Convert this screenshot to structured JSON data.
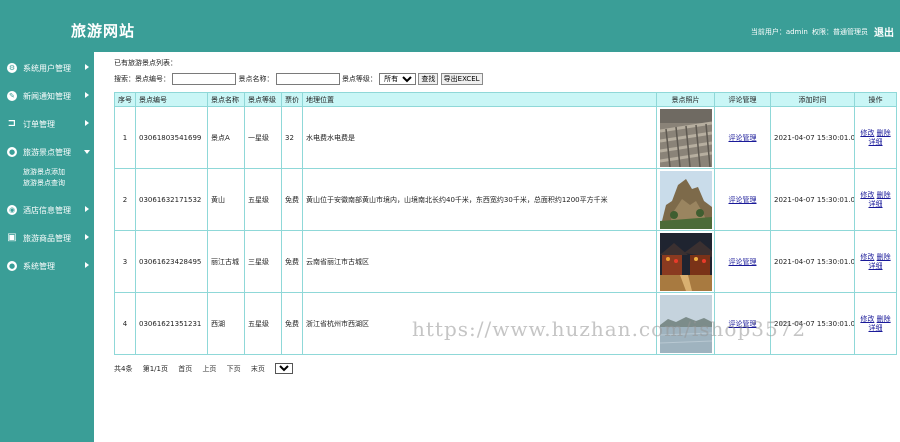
{
  "header": {
    "site_title": "旅游网站",
    "user_label": "当前用户：admin",
    "role_label": "权限：普通管理员",
    "logout_label": "退出",
    "bg_color": "#3a9e97"
  },
  "sidebar": {
    "items": [
      {
        "label": "系统用户管理",
        "icon": "settings-circle-icon"
      },
      {
        "label": "新闻通知管理",
        "icon": "edit-icon"
      },
      {
        "label": "订单管理",
        "icon": "bracket-icon"
      },
      {
        "label": "旅游景点管理",
        "icon": "people-icon"
      },
      {
        "label": "酒店信息管理",
        "icon": "circle-dot-icon"
      },
      {
        "label": "旅游商品管理",
        "icon": "box-icon"
      },
      {
        "label": "系统管理",
        "icon": "people-icon"
      }
    ],
    "sub_items": [
      "旅游景点添加",
      "旅游景点查询"
    ]
  },
  "main": {
    "list_caption": "已有旅游景点列表：",
    "search": {
      "prefix": "搜索：",
      "code_label": "景点编号：",
      "name_label": "景点名称：",
      "level_label": "景点等级：",
      "level_selected": "所有",
      "search_button": "查找",
      "export_button": "导出EXCEL"
    },
    "columns": [
      "序号",
      "景点编号",
      "景点名称",
      "景点等级",
      "票价",
      "地理位置",
      "景点照片",
      "评论管理",
      "添加时间",
      "操作"
    ],
    "rows": [
      {
        "no": "1",
        "code": "03061803541699",
        "name": "景点A",
        "level": "一星级",
        "price": "32",
        "location": "水电费水电费是",
        "photo": "terracotta-warriors",
        "comment": "评论管理",
        "time": "2021-04-07 15:30:01.0",
        "edit": "修改",
        "delete": "删除",
        "detail": "详细"
      },
      {
        "no": "2",
        "code": "03061632171532",
        "name": "黄山",
        "level": "五星级",
        "price": "免费",
        "location": "黄山位于安徽南部黄山市境内，山境南北长约40千米，东西宽约30千米，总面积约1200平方千米",
        "photo": "huangshan-mountain",
        "comment": "评论管理",
        "time": "2021-04-07 15:30:01.0",
        "edit": "修改",
        "delete": "删除",
        "detail": "详细"
      },
      {
        "no": "3",
        "code": "03061623428495",
        "name": "丽江古城",
        "level": "三星级",
        "price": "免费",
        "location": "云南省丽江市古城区",
        "photo": "lijiang-old-town",
        "comment": "评论管理",
        "time": "2021-04-07 15:30:01.0",
        "edit": "修改",
        "delete": "删除",
        "detail": "详细"
      },
      {
        "no": "4",
        "code": "03061621351231",
        "name": "西湖",
        "level": "五星级",
        "price": "免费",
        "location": "浙江省杭州市西湖区",
        "photo": "west-lake",
        "comment": "评论管理",
        "time": "2021-04-07 15:30:01.0",
        "edit": "修改",
        "delete": "删除",
        "detail": "详细"
      }
    ],
    "pager": {
      "total": "共4条",
      "page_info": "第1/1页",
      "first": "首页",
      "prev": "上页",
      "next": "下页",
      "last": "末页",
      "page_selected": "1"
    }
  },
  "watermark": "https://www.huzhan.com/ishop3572"
}
